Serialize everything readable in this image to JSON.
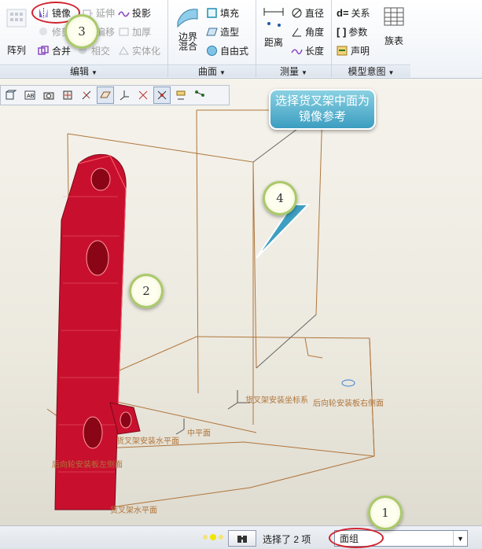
{
  "ribbon": {
    "groups": {
      "edit": {
        "label": "编辑",
        "array_label": "阵列",
        "mirror": "镜像",
        "extend": "延伸",
        "project": "投影",
        "trim": "修剪",
        "offset": "偏移",
        "thicken": "加厚",
        "merge": "合并",
        "intersect": "相交",
        "solidify": "实体化"
      },
      "surface": {
        "label": "曲面",
        "boundary_blend": "边界\n混合",
        "fill": "填充",
        "style": "造型",
        "freeform": "自由式"
      },
      "measure": {
        "label": "测量",
        "distance": "距离",
        "diameter": "直径",
        "angle": "角度",
        "length": "长度"
      },
      "model_intent": {
        "label": "模型意图",
        "relations": "关系",
        "parameters": "参数",
        "declare": "声明",
        "family_table": "族表"
      }
    }
  },
  "viewport": {
    "callout_text": "选择货叉架中面为镜像参考",
    "annotations": {
      "fork_csys": "货叉架安装坐标系",
      "rear_wheel_right": "后向轮安装板右侧面",
      "rear_wheel_left": "后向轮安装板左侧面",
      "fork_horizontal": "货叉架水平面",
      "fork_plane_partial": "货叉架安装水平面",
      "center_plane": "中平面"
    },
    "badges": [
      "3",
      "4",
      "2",
      "1"
    ]
  },
  "statusbar": {
    "selection_text": "选择了 2 项",
    "filter_value": "面组"
  },
  "colors": {
    "accent": "#d0232f",
    "part": "#c8102e",
    "datum": "#b0753a"
  }
}
